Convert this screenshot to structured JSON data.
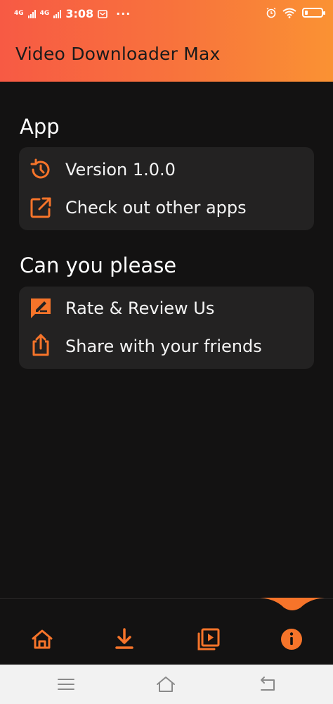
{
  "status_bar": {
    "network": "4G",
    "network2": "4G",
    "time": "3:08",
    "dots": "···"
  },
  "header": {
    "title": "Video Downloader Max"
  },
  "sections": [
    {
      "title": "App",
      "items": [
        {
          "label": "Version 1.0.0",
          "icon": "history-icon"
        },
        {
          "label": "Check out other apps",
          "icon": "external-link-icon"
        }
      ]
    },
    {
      "title": "Can you please",
      "items": [
        {
          "label": "Rate & Review Us",
          "icon": "rate-review-icon"
        },
        {
          "label": "Share with your friends",
          "icon": "share-icon"
        }
      ]
    }
  ],
  "bottom_nav": [
    {
      "name": "home",
      "icon": "home-icon",
      "active": false
    },
    {
      "name": "downloads",
      "icon": "download-icon",
      "active": false
    },
    {
      "name": "videos",
      "icon": "video-library-icon",
      "active": false
    },
    {
      "name": "info",
      "icon": "info-icon",
      "active": true
    }
  ],
  "colors": {
    "accent": "#f6742a",
    "header_start": "#f75a44",
    "header_end": "#fa9233",
    "background": "#131212",
    "card": "#232222"
  }
}
